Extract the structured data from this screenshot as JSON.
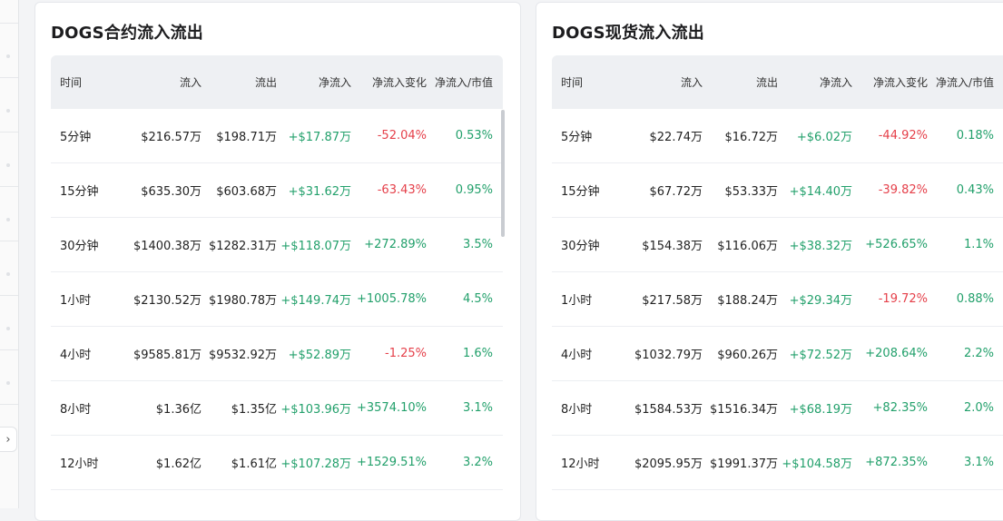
{
  "contract": {
    "title": "DOGS合约流入流出",
    "headers": [
      "时间",
      "流入",
      "流出",
      "净流入",
      "净流入变化",
      "净流入/市值"
    ],
    "rows": [
      {
        "time": "5分钟",
        "inflow": "$216.57万",
        "outflow": "$198.71万",
        "net": "+$17.87万",
        "change": "-52.04%",
        "ratio": "0.53%"
      },
      {
        "time": "15分钟",
        "inflow": "$635.30万",
        "outflow": "$603.68万",
        "net": "+$31.62万",
        "change": "-63.43%",
        "ratio": "0.95%"
      },
      {
        "time": "30分钟",
        "inflow": "$1400.38万",
        "outflow": "$1282.31万",
        "net": "+$118.07万",
        "change": "+272.89%",
        "ratio": "3.5%"
      },
      {
        "time": "1小时",
        "inflow": "$2130.52万",
        "outflow": "$1980.78万",
        "net": "+$149.74万",
        "change": "+1005.78%",
        "ratio": "4.5%"
      },
      {
        "time": "4小时",
        "inflow": "$9585.81万",
        "outflow": "$9532.92万",
        "net": "+$52.89万",
        "change": "-1.25%",
        "ratio": "1.6%"
      },
      {
        "time": "8小时",
        "inflow": "$1.36亿",
        "outflow": "$1.35亿",
        "net": "+$103.96万",
        "change": "+3574.10%",
        "ratio": "3.1%"
      },
      {
        "time": "12小时",
        "inflow": "$1.62亿",
        "outflow": "$1.61亿",
        "net": "+$107.28万",
        "change": "+1529.51%",
        "ratio": "3.2%"
      }
    ]
  },
  "spot": {
    "title": "DOGS现货流入流出",
    "headers": [
      "时间",
      "流入",
      "流出",
      "净流入",
      "净流入变化",
      "净流入/市值"
    ],
    "rows": [
      {
        "time": "5分钟",
        "inflow": "$22.74万",
        "outflow": "$16.72万",
        "net": "+$6.02万",
        "change": "-44.92%",
        "ratio": "0.18%"
      },
      {
        "time": "15分钟",
        "inflow": "$67.72万",
        "outflow": "$53.33万",
        "net": "+$14.40万",
        "change": "-39.82%",
        "ratio": "0.43%"
      },
      {
        "time": "30分钟",
        "inflow": "$154.38万",
        "outflow": "$116.06万",
        "net": "+$38.32万",
        "change": "+526.65%",
        "ratio": "1.1%"
      },
      {
        "time": "1小时",
        "inflow": "$217.58万",
        "outflow": "$188.24万",
        "net": "+$29.34万",
        "change": "-19.72%",
        "ratio": "0.88%"
      },
      {
        "time": "4小时",
        "inflow": "$1032.79万",
        "outflow": "$960.26万",
        "net": "+$72.52万",
        "change": "+208.64%",
        "ratio": "2.2%"
      },
      {
        "time": "8小时",
        "inflow": "$1584.53万",
        "outflow": "$1516.34万",
        "net": "+$68.19万",
        "change": "+82.35%",
        "ratio": "2.0%"
      },
      {
        "time": "12小时",
        "inflow": "$2095.95万",
        "outflow": "$1991.37万",
        "net": "+$104.58万",
        "change": "+872.35%",
        "ratio": "3.1%"
      }
    ]
  },
  "colors": {
    "positive": "#22a06b",
    "negative": "#e5404a",
    "header_bg": "#eef0f3"
  },
  "icons": {
    "expand": "chevron-right-icon"
  },
  "expand_glyph": "›"
}
